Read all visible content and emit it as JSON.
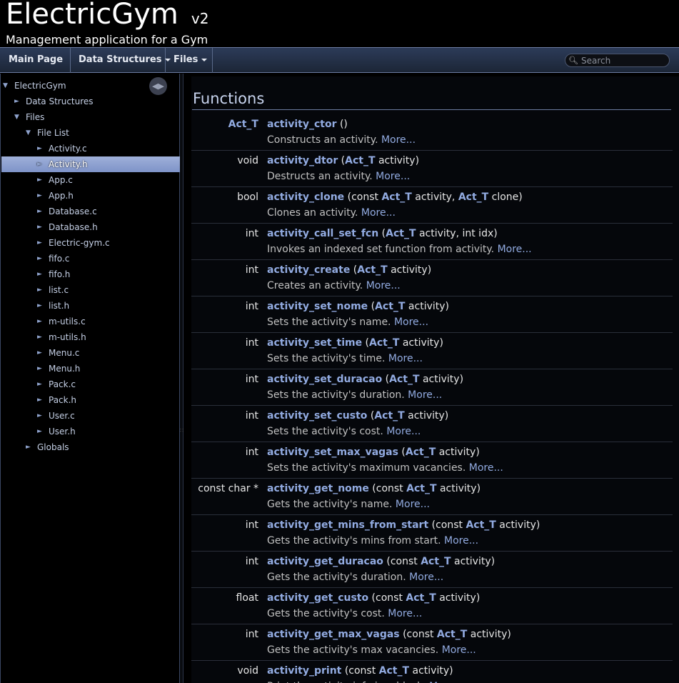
{
  "header": {
    "project_name": "ElectricGym",
    "project_number": "v2",
    "project_brief": "Management application for a Gym"
  },
  "navbar": {
    "items": [
      {
        "label": "Main Page",
        "has_menu": false
      },
      {
        "label": "Data Structures",
        "has_menu": true
      },
      {
        "label": "Files",
        "has_menu": true
      }
    ],
    "search_placeholder": "Search"
  },
  "tree": [
    {
      "label": "ElectricGym",
      "expanded": true,
      "level": 0
    },
    {
      "label": "Data Structures",
      "expanded": false,
      "level": 1
    },
    {
      "label": "Files",
      "expanded": true,
      "level": 1
    },
    {
      "label": "File List",
      "expanded": true,
      "level": 2
    },
    {
      "label": "Activity.c",
      "expanded": false,
      "level": 3
    },
    {
      "label": "Activity.h",
      "expanded": false,
      "level": 3,
      "selected": true
    },
    {
      "label": "App.c",
      "expanded": false,
      "level": 3
    },
    {
      "label": "App.h",
      "expanded": false,
      "level": 3
    },
    {
      "label": "Database.c",
      "expanded": false,
      "level": 3
    },
    {
      "label": "Database.h",
      "expanded": false,
      "level": 3
    },
    {
      "label": "Electric-gym.c",
      "expanded": false,
      "level": 3
    },
    {
      "label": "fifo.c",
      "expanded": false,
      "level": 3
    },
    {
      "label": "fifo.h",
      "expanded": false,
      "level": 3
    },
    {
      "label": "list.c",
      "expanded": false,
      "level": 3
    },
    {
      "label": "list.h",
      "expanded": false,
      "level": 3
    },
    {
      "label": "m-utils.c",
      "expanded": false,
      "level": 3
    },
    {
      "label": "m-utils.h",
      "expanded": false,
      "level": 3
    },
    {
      "label": "Menu.c",
      "expanded": false,
      "level": 3
    },
    {
      "label": "Menu.h",
      "expanded": false,
      "level": 3
    },
    {
      "label": "Pack.c",
      "expanded": false,
      "level": 3
    },
    {
      "label": "Pack.h",
      "expanded": false,
      "level": 3
    },
    {
      "label": "User.c",
      "expanded": false,
      "level": 3
    },
    {
      "label": "User.h",
      "expanded": false,
      "level": 3
    },
    {
      "label": "Globals",
      "expanded": false,
      "level": 2
    }
  ],
  "content": {
    "section_title": "Functions",
    "more_label": "More...",
    "functions": [
      {
        "ret": "Act_T",
        "ret_link": true,
        "name": "activity_ctor",
        "params": [
          {
            "text": " ()"
          }
        ],
        "desc": "Constructs an activity."
      },
      {
        "ret": "void",
        "ret_link": false,
        "name": "activity_dtor",
        "params": [
          {
            "text": " ("
          },
          {
            "link": "Act_T"
          },
          {
            "text": " activity)"
          }
        ],
        "desc": "Destructs an activity."
      },
      {
        "ret": "bool",
        "ret_link": false,
        "name": "activity_clone",
        "params": [
          {
            "text": " (const "
          },
          {
            "link": "Act_T"
          },
          {
            "text": " activity, "
          },
          {
            "link": "Act_T"
          },
          {
            "text": " clone)"
          }
        ],
        "desc": "Clones an activity."
      },
      {
        "ret": "int",
        "ret_link": false,
        "name": "activity_call_set_fcn",
        "params": [
          {
            "text": " ("
          },
          {
            "link": "Act_T"
          },
          {
            "text": " activity, int idx)"
          }
        ],
        "desc": "Invokes an indexed set function from activity."
      },
      {
        "ret": "int",
        "ret_link": false,
        "name": "activity_create",
        "params": [
          {
            "text": " ("
          },
          {
            "link": "Act_T"
          },
          {
            "text": " activity)"
          }
        ],
        "desc": "Creates an activity."
      },
      {
        "ret": "int",
        "ret_link": false,
        "name": "activity_set_nome",
        "params": [
          {
            "text": " ("
          },
          {
            "link": "Act_T"
          },
          {
            "text": " activity)"
          }
        ],
        "desc": "Sets the activity's name."
      },
      {
        "ret": "int",
        "ret_link": false,
        "name": "activity_set_time",
        "params": [
          {
            "text": " ("
          },
          {
            "link": "Act_T"
          },
          {
            "text": " activity)"
          }
        ],
        "desc": "Sets the activity's time."
      },
      {
        "ret": "int",
        "ret_link": false,
        "name": "activity_set_duracao",
        "params": [
          {
            "text": " ("
          },
          {
            "link": "Act_T"
          },
          {
            "text": " activity)"
          }
        ],
        "desc": "Sets the activity's duration."
      },
      {
        "ret": "int",
        "ret_link": false,
        "name": "activity_set_custo",
        "params": [
          {
            "text": " ("
          },
          {
            "link": "Act_T"
          },
          {
            "text": " activity)"
          }
        ],
        "desc": "Sets the activity's cost."
      },
      {
        "ret": "int",
        "ret_link": false,
        "name": "activity_set_max_vagas",
        "params": [
          {
            "text": " ("
          },
          {
            "link": "Act_T"
          },
          {
            "text": " activity)"
          }
        ],
        "desc": "Sets the activity's maximum vacancies."
      },
      {
        "ret": "const char *",
        "ret_link": false,
        "name": "activity_get_nome",
        "params": [
          {
            "text": " (const "
          },
          {
            "link": "Act_T"
          },
          {
            "text": " activity)"
          }
        ],
        "desc": "Gets the activity's name."
      },
      {
        "ret": "int",
        "ret_link": false,
        "name": "activity_get_mins_from_start",
        "params": [
          {
            "text": " (const "
          },
          {
            "link": "Act_T"
          },
          {
            "text": " activity)"
          }
        ],
        "desc": "Gets the activity's mins from start."
      },
      {
        "ret": "int",
        "ret_link": false,
        "name": "activity_get_duracao",
        "params": [
          {
            "text": " (const "
          },
          {
            "link": "Act_T"
          },
          {
            "text": " activity)"
          }
        ],
        "desc": "Gets the activity's duration."
      },
      {
        "ret": "float",
        "ret_link": false,
        "name": "activity_get_custo",
        "params": [
          {
            "text": " (const "
          },
          {
            "link": "Act_T"
          },
          {
            "text": " activity)"
          }
        ],
        "desc": "Gets the activity's cost."
      },
      {
        "ret": "int",
        "ret_link": false,
        "name": "activity_get_max_vagas",
        "params": [
          {
            "text": " (const "
          },
          {
            "link": "Act_T"
          },
          {
            "text": " activity)"
          }
        ],
        "desc": "Gets the activity's max vacancies."
      },
      {
        "ret": "void",
        "ret_link": false,
        "name": "activity_print",
        "params": [
          {
            "text": " (const "
          },
          {
            "link": "Act_T"
          },
          {
            "text": " activity)"
          }
        ],
        "desc": "Print the activity info in a block."
      }
    ]
  },
  "icons": {
    "search": "search-icon",
    "sync": "sync-icon",
    "expanded_arrow": "triangle-down-icon",
    "collapsed_arrow": "triangle-right-icon"
  }
}
